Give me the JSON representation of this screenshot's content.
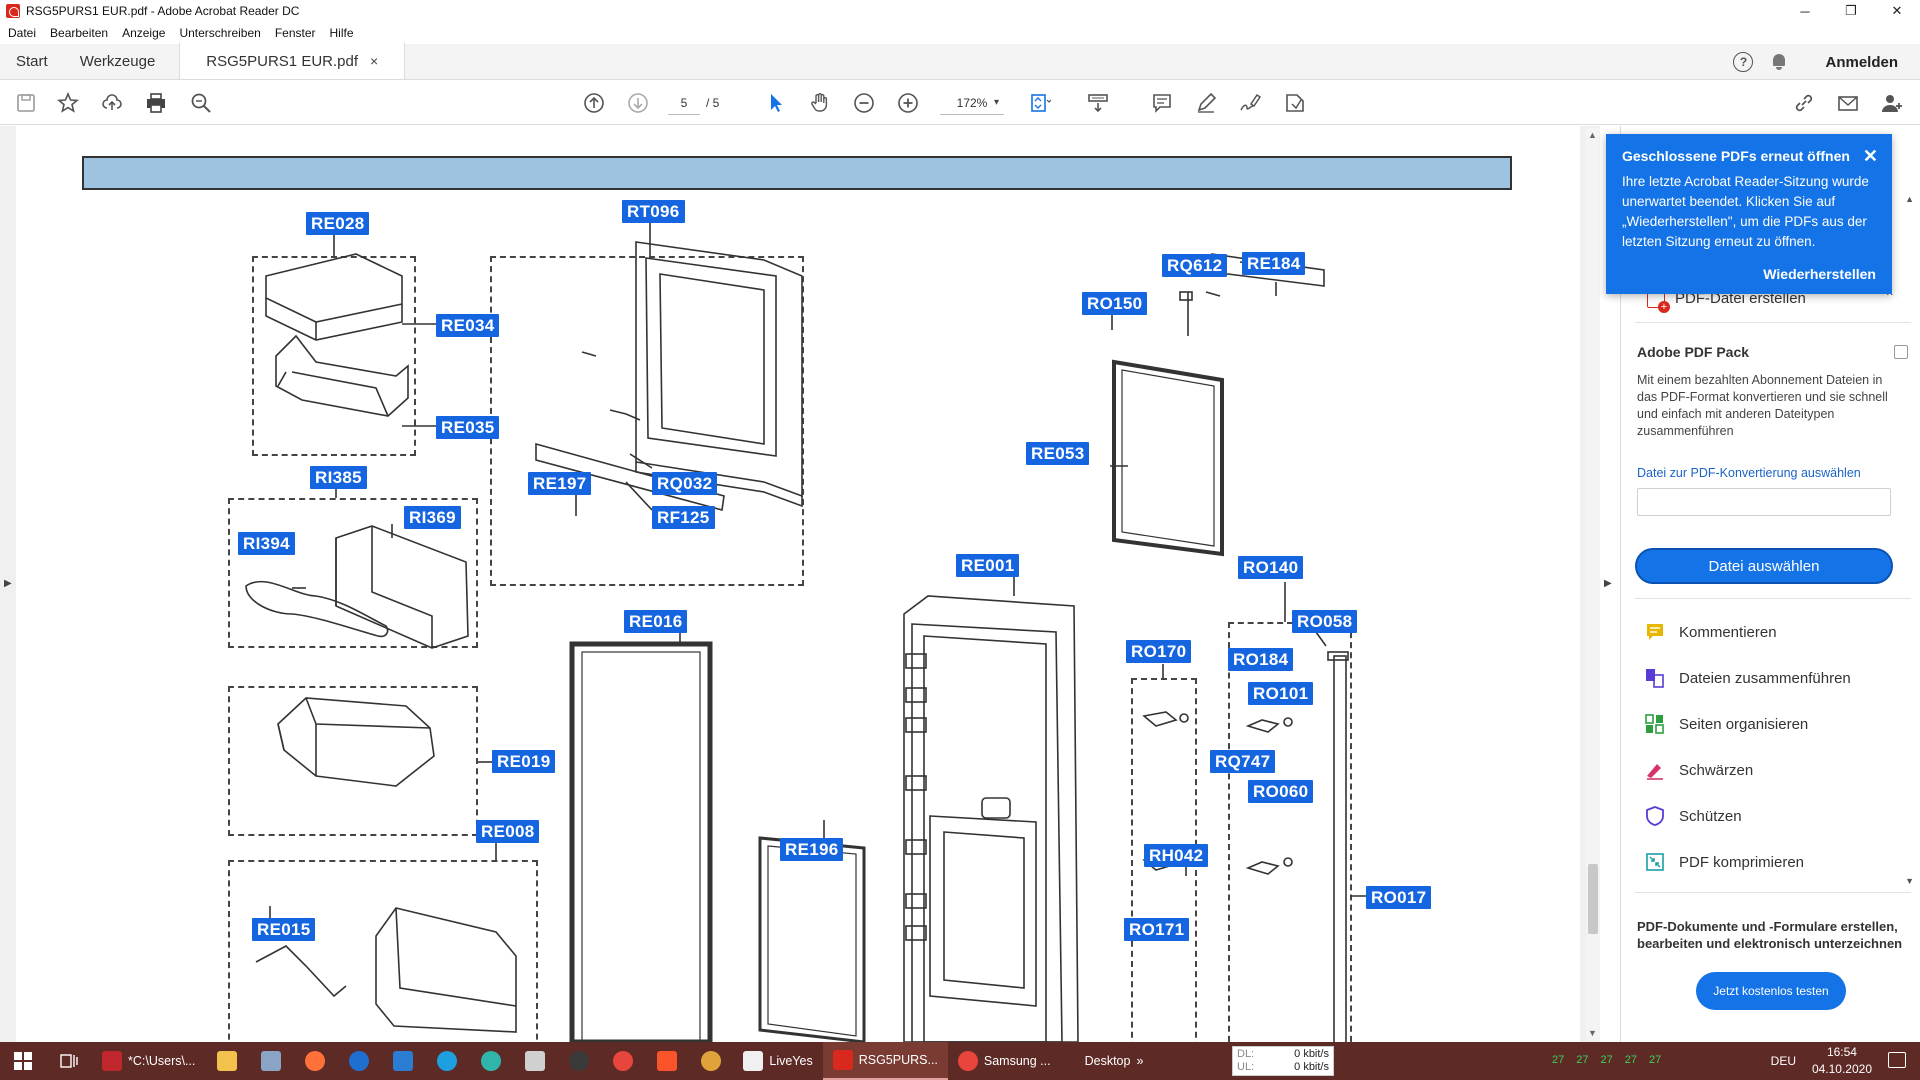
{
  "window": {
    "title": "RSG5PURS1 EUR.pdf - Adobe Acrobat Reader DC",
    "minimize": "─",
    "maximize": "❐",
    "close": "✕"
  },
  "menu": [
    "Datei",
    "Bearbeiten",
    "Anzeige",
    "Unterschreiben",
    "Fenster",
    "Hilfe"
  ],
  "tabs": {
    "start": "Start",
    "tools": "Werkzeuge",
    "document": "RSG5PURS1 EUR.pdf",
    "close": "×",
    "sign_in": "Anmelden",
    "help": "?"
  },
  "toolbar": {
    "page_current": "5",
    "page_total": "/ 5",
    "zoom": "172%",
    "zoom_caret": "▾",
    "icons": [
      "save-icon",
      "star-icon",
      "upload-cloud-icon",
      "print-icon",
      "search-zoom-icon",
      "page-up-icon",
      "page-down-icon",
      "select-arrow-icon",
      "hand-icon",
      "zoom-out-icon",
      "zoom-in-icon",
      "fit-page-icon",
      "scroll-mode-icon",
      "comment-icon",
      "pen-icon",
      "sign-icon",
      "share-icon",
      "link-icon",
      "mail-icon",
      "add-user-icon"
    ]
  },
  "diagram": {
    "labels": [
      {
        "id": "RE028"
      },
      {
        "id": "RE034"
      },
      {
        "id": "RE035"
      },
      {
        "id": "RT096"
      },
      {
        "id": "RI385"
      },
      {
        "id": "RI369"
      },
      {
        "id": "RI394"
      },
      {
        "id": "RE197"
      },
      {
        "id": "RQ032"
      },
      {
        "id": "RF125"
      },
      {
        "id": "RQ612"
      },
      {
        "id": "RE184"
      },
      {
        "id": "RO150"
      },
      {
        "id": "RE053"
      },
      {
        "id": "RE001"
      },
      {
        "id": "RE016"
      },
      {
        "id": "RO140"
      },
      {
        "id": "RO058"
      },
      {
        "id": "RO170"
      },
      {
        "id": "RO184"
      },
      {
        "id": "RO101"
      },
      {
        "id": "RQ747"
      },
      {
        "id": "RO060"
      },
      {
        "id": "RE019"
      },
      {
        "id": "RE008"
      },
      {
        "id": "RE196"
      },
      {
        "id": "RH042"
      },
      {
        "id": "RO171"
      },
      {
        "id": "RO017"
      },
      {
        "id": "RE015"
      }
    ]
  },
  "notification": {
    "title": "Geschlossene PDFs erneut öffnen",
    "body": "Ihre letzte Acrobat Reader-Sitzung wurde unerwartet beendet. Klicken Sie auf „Wiederherstellen\", um die PDFs aus der letzten Sitzung erneut zu öffnen.",
    "action": "Wiederherstellen",
    "close": "✕"
  },
  "right_panel": {
    "create_pdf": "PDF-Datei erstellen",
    "chevron": "^",
    "pack_title": "Adobe PDF Pack",
    "pack_desc": "Mit einem bezahlten Abonnement Dateien in das PDF-Format konvertieren und sie schnell und einfach mit anderen Dateitypen zusammenführen",
    "pack_link": "Datei zur PDF-Konvertierung auswählen",
    "pack_button": "Datei auswählen",
    "tools": [
      {
        "label": "Kommentieren",
        "icon": "comment-icon",
        "color": "#e8b800"
      },
      {
        "label": "Dateien zusammenführen",
        "icon": "combine-files-icon",
        "color": "#5a3bd6"
      },
      {
        "label": "Seiten organisieren",
        "icon": "organize-pages-icon",
        "color": "#2e9e3f"
      },
      {
        "label": "Schwärzen",
        "icon": "redact-icon",
        "color": "#d6336c"
      },
      {
        "label": "Schützen",
        "icon": "shield-icon",
        "color": "#5a3bd6"
      },
      {
        "label": "PDF komprimieren",
        "icon": "compress-icon",
        "color": "#1c9ea6"
      }
    ],
    "promo_text": "PDF-Dokumente und -Formulare erstellen, bearbeiten und elektronisch unterzeichnen",
    "promo_button": "Jetzt kostenlos testen"
  },
  "taskbar": {
    "explorer_path": "*C:\\Users\\...",
    "liveyes": "LiveYes",
    "acrobat": "RSG5PURS...",
    "samsung": "Samsung ...",
    "desktop": "Desktop",
    "desktop_chevron": "»",
    "net_dl": "DL:",
    "net_dl_val": "0 kbit/s",
    "net_ul": "UL:",
    "net_ul_val": "0 kbit/s",
    "tray_nums": [
      "27",
      "27",
      "27",
      "27",
      "27"
    ],
    "lang": "DEU",
    "time": "16:54",
    "date": "04.10.2020"
  },
  "colors": {
    "label_blue": "#1565e0",
    "accent": "#1473e6",
    "taskbar": "#5e2a25",
    "header_band": "#9ec3e0"
  }
}
